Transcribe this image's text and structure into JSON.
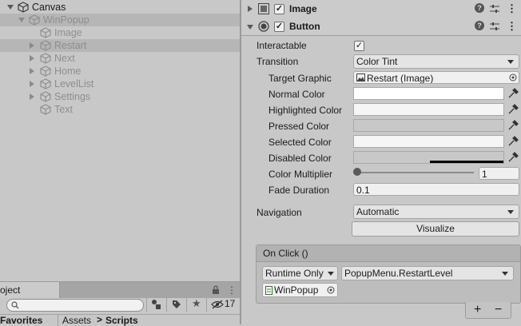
{
  "hierarchy": {
    "items": [
      {
        "label": "Canvas",
        "expanded": true,
        "dim": false,
        "selected": false,
        "depth": 0,
        "arrow": "down"
      },
      {
        "label": "WinPopup",
        "expanded": true,
        "dim": true,
        "selected": true,
        "depth": 1,
        "arrow": "down"
      },
      {
        "label": "Image",
        "dim": true,
        "selected": false,
        "depth": 2,
        "arrow": "none"
      },
      {
        "label": "Restart",
        "dim": true,
        "selected": true,
        "depth": 2,
        "arrow": "right"
      },
      {
        "label": "Next",
        "dim": true,
        "selected": false,
        "depth": 2,
        "arrow": "right"
      },
      {
        "label": "Home",
        "dim": true,
        "selected": false,
        "depth": 2,
        "arrow": "right"
      },
      {
        "label": "LevelList",
        "dim": true,
        "selected": false,
        "depth": 2,
        "arrow": "right"
      },
      {
        "label": "Settings",
        "dim": true,
        "selected": false,
        "depth": 2,
        "arrow": "right"
      },
      {
        "label": "Text",
        "dim": true,
        "selected": false,
        "depth": 2,
        "arrow": "none"
      }
    ]
  },
  "project": {
    "tab_label": "oject",
    "hidden_count": "17",
    "favorites_label": "Favorites",
    "breadcrumb_root": "Assets",
    "breadcrumb_sep": ">",
    "breadcrumb_current": "Scripts",
    "search_placeholder": ""
  },
  "inspector": {
    "image_component": {
      "title": "Image",
      "enabled": true
    },
    "button_component": {
      "title": "Button",
      "enabled": true
    },
    "labels": {
      "interactable": "Interactable",
      "transition": "Transition",
      "target_graphic": "Target Graphic",
      "normal_color": "Normal Color",
      "highlighted_color": "Highlighted Color",
      "pressed_color": "Pressed Color",
      "selected_color": "Selected Color",
      "disabled_color": "Disabled Color",
      "color_multiplier": "Color Multiplier",
      "fade_duration": "Fade Duration",
      "navigation": "Navigation"
    },
    "values": {
      "interactable": true,
      "transition": "Color Tint",
      "target_graphic": "Restart (Image)",
      "color_multiplier": "1",
      "color_multiplier_fraction": 0.0,
      "fade_duration": "0.1",
      "navigation": "Automatic"
    },
    "colors": {
      "normal": "#ffffff",
      "highlighted": "#f5f5f5",
      "pressed": "#c8c8c8",
      "selected": "#f5f5f5",
      "disabled": "#c8c8c8"
    },
    "visualize_label": "Visualize",
    "on_click": {
      "header": "On Click ()",
      "runtime": "Runtime Only",
      "function": "PopupMenu.RestartLevel",
      "object": "WinPopup",
      "add_label": "+",
      "remove_label": "−"
    }
  }
}
